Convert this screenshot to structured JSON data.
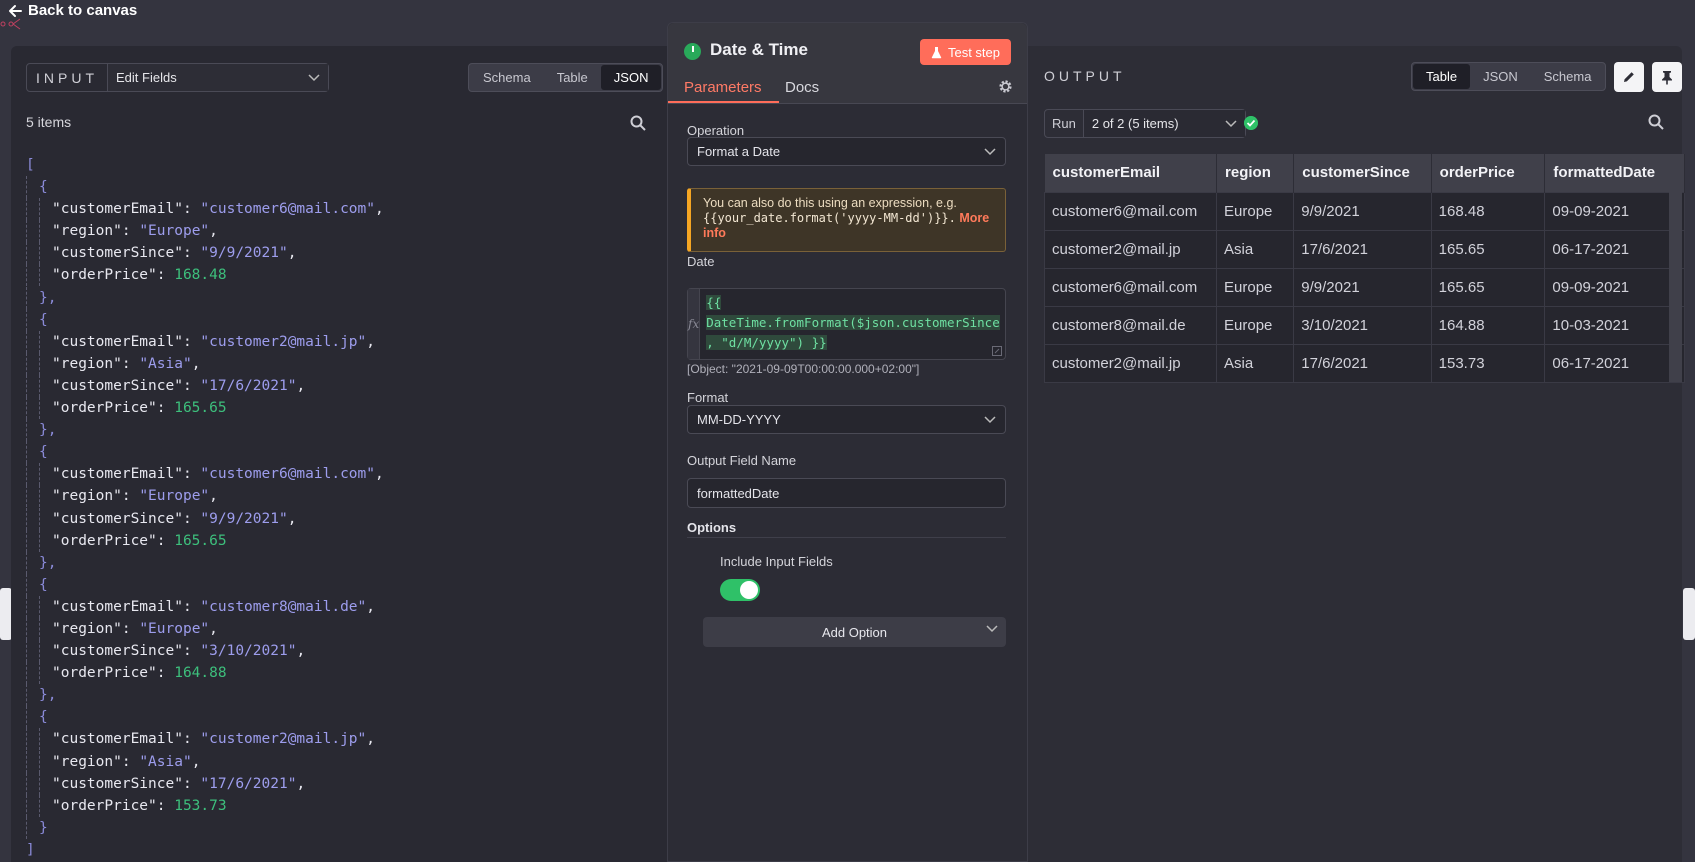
{
  "top": {
    "back_label": "Back to canvas"
  },
  "input_panel": {
    "label": "INPUT",
    "node_select": "Edit Fields",
    "view_tabs": [
      "Schema",
      "Table",
      "JSON"
    ],
    "active_tab": "JSON",
    "items_count": "5 items",
    "items": [
      {
        "customerEmail": "customer6@mail.com",
        "region": "Europe",
        "customerSince": "9/9/2021",
        "orderPrice": "168.48"
      },
      {
        "customerEmail": "customer2@mail.jp",
        "region": "Asia",
        "customerSince": "17/6/2021",
        "orderPrice": "165.65"
      },
      {
        "customerEmail": "customer6@mail.com",
        "region": "Europe",
        "customerSince": "9/9/2021",
        "orderPrice": "165.65"
      },
      {
        "customerEmail": "customer8@mail.de",
        "region": "Europe",
        "customerSince": "3/10/2021",
        "orderPrice": "164.88"
      },
      {
        "customerEmail": "customer2@mail.jp",
        "region": "Asia",
        "customerSince": "17/6/2021",
        "orderPrice": "153.73"
      }
    ]
  },
  "node": {
    "title": "Date & Time",
    "test_label": "Test step",
    "tabs": {
      "parameters": "Parameters",
      "docs": "Docs"
    },
    "operation_label": "Operation",
    "operation_value": "Format a Date",
    "notice": {
      "text": "You can also do this using an expression, e.g.",
      "code": "{{your_date.format('yyyy-MM-dd')}}.",
      "more": "More info"
    },
    "date_label": "Date",
    "date_expr_1": "{{ ",
    "date_expr_2": "DateTime.fromFormat($json.customerSince",
    "date_expr_3": ", \"d/M/yyyy\") }}",
    "date_result": "[Object: \"2021-09-09T00:00:00.000+02:00\"]",
    "format_label": "Format",
    "format_value": "MM-DD-YYYY",
    "output_field_label": "Output Field Name",
    "output_field_value": "formattedDate",
    "options_label": "Options",
    "include_input_label": "Include Input Fields",
    "include_input_on": true,
    "add_option_label": "Add Option"
  },
  "output_panel": {
    "label": "OUTPUT",
    "view_tabs": [
      "Table",
      "JSON",
      "Schema"
    ],
    "active_tab": "Table",
    "run_label": "Run",
    "run_value": "2 of 2 (5 items)",
    "columns": [
      "customerEmail",
      "region",
      "customerSince",
      "orderPrice",
      "formattedDate"
    ],
    "rows": [
      [
        "customer6@mail.com",
        "Europe",
        "9/9/2021",
        "168.48",
        "09-09-2021"
      ],
      [
        "customer2@mail.jp",
        "Asia",
        "17/6/2021",
        "165.65",
        "06-17-2021"
      ],
      [
        "customer6@mail.com",
        "Europe",
        "9/9/2021",
        "165.65",
        "09-09-2021"
      ],
      [
        "customer8@mail.de",
        "Europe",
        "3/10/2021",
        "164.88",
        "10-03-2021"
      ],
      [
        "customer2@mail.jp",
        "Asia",
        "17/6/2021",
        "153.73",
        "06-17-2021"
      ]
    ]
  },
  "colors": {
    "accent": "#ff6d5a",
    "success": "#2fc168",
    "warning": "#f5a623"
  },
  "icons": [
    "arrow-left-icon",
    "chevron-down-icon",
    "search-icon",
    "clock-icon",
    "flask-icon",
    "gear-icon",
    "pencil-icon",
    "pin-icon",
    "check-circle-icon",
    "expand-icon"
  ]
}
